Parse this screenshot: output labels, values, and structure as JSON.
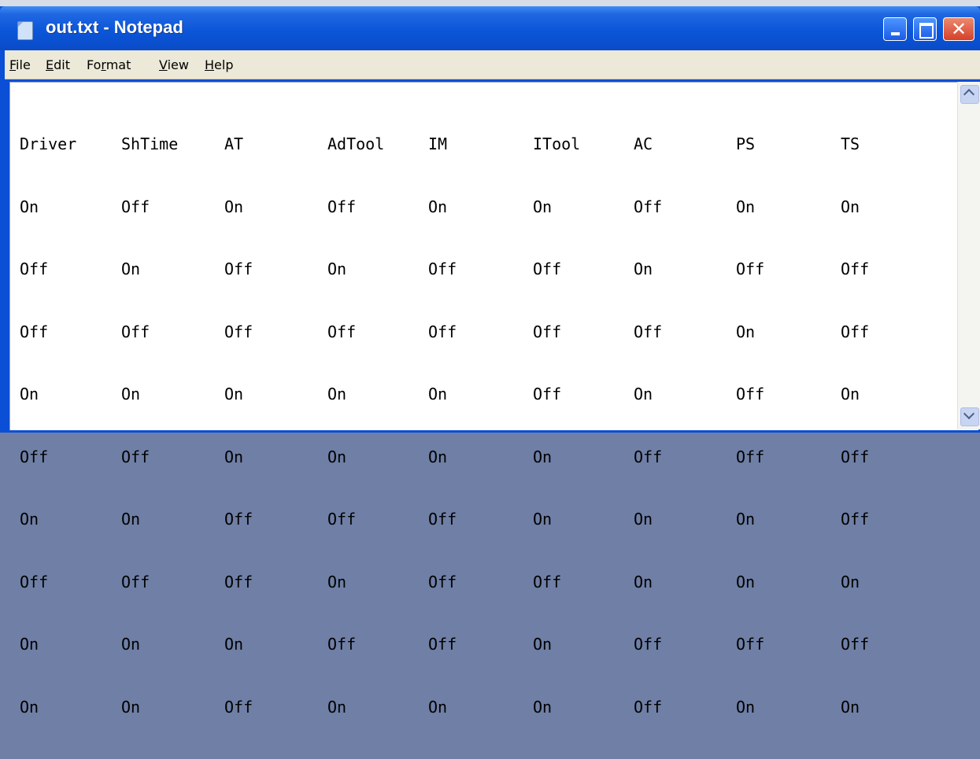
{
  "window": {
    "title": "out.txt - Notepad"
  },
  "menu": [
    {
      "first": "F",
      "rest": "ile"
    },
    {
      "first": "E",
      "rest": "dit"
    },
    {
      "first": "Fo",
      "under": "r",
      "rest": "mat"
    },
    {
      "first": "V",
      "rest": "iew"
    },
    {
      "first": "H",
      "rest": "elp"
    }
  ],
  "document": {
    "rows": [
      [
        "Driver",
        "ShTime",
        "AT",
        "AdTool",
        "IM",
        "ITool",
        "AC",
        "PS",
        "TS"
      ],
      [
        "On",
        "Off",
        "On",
        "Off",
        "On",
        "On",
        "Off",
        "On",
        "On"
      ],
      [
        "Off",
        "On",
        "Off",
        "On",
        "Off",
        "Off",
        "On",
        "Off",
        "Off"
      ],
      [
        "Off",
        "Off",
        "Off",
        "Off",
        "Off",
        "Off",
        "Off",
        "On",
        "Off"
      ],
      [
        "On",
        "On",
        "On",
        "On",
        "On",
        "Off",
        "On",
        "Off",
        "On"
      ],
      [
        "Off",
        "Off",
        "On",
        "On",
        "On",
        "On",
        "Off",
        "Off",
        "Off"
      ],
      [
        "On",
        "On",
        "Off",
        "Off",
        "Off",
        "On",
        "On",
        "On",
        "Off"
      ],
      [
        "Off",
        "Off",
        "Off",
        "On",
        "Off",
        "Off",
        "On",
        "On",
        "On"
      ],
      [
        "On",
        "On",
        "On",
        "Off",
        "Off",
        "On",
        "Off",
        "Off",
        "Off"
      ],
      [
        "On",
        "On",
        "Off",
        "On",
        "On",
        "On",
        "Off",
        "On",
        "On"
      ]
    ]
  },
  "colors": {
    "title_bar": "#0a56d9",
    "menu_bar": "#ece9d8",
    "close_button": "#d5402a"
  }
}
